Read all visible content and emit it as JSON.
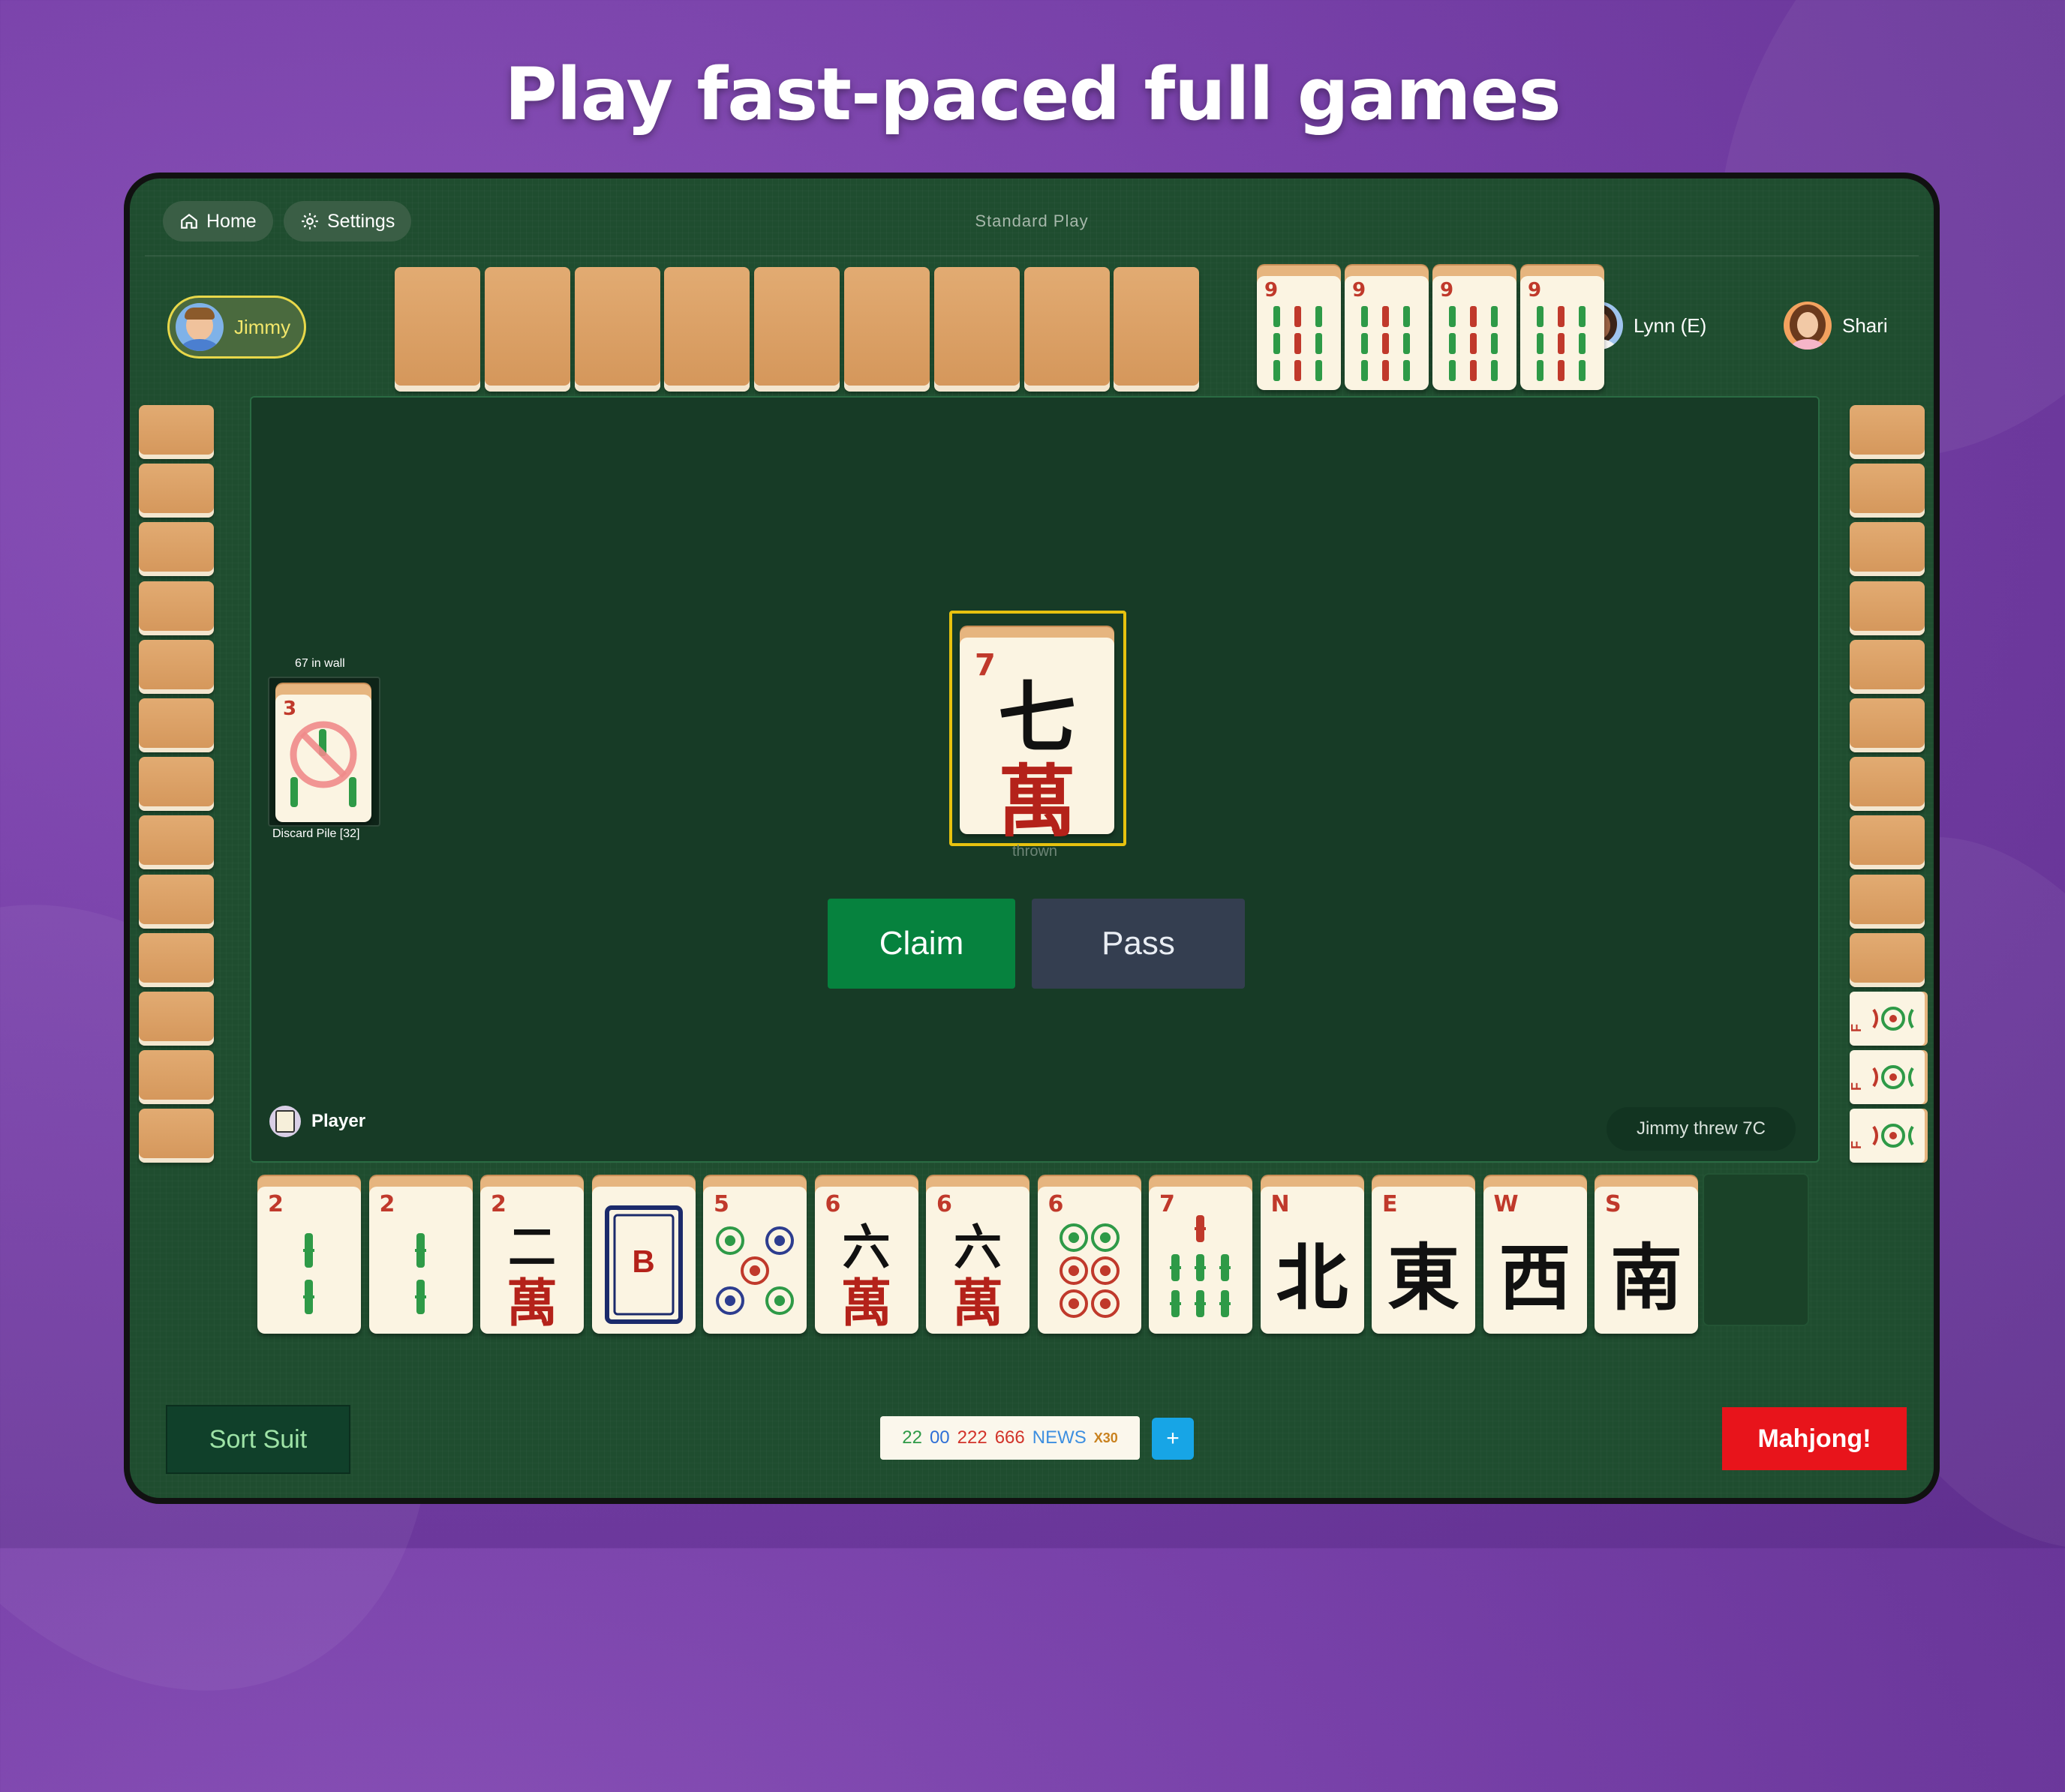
{
  "headline": "Play fast-paced full games",
  "nav": {
    "home": "Home",
    "settings": "Settings",
    "mode": "Standard Play"
  },
  "players": {
    "north": {
      "name": "Jimmy"
    },
    "east": {
      "name": "Lynn (E)"
    },
    "west": {
      "name": "Shari"
    },
    "south": {
      "name": "Player"
    }
  },
  "opponent_top": {
    "hidden_tiles": 9,
    "exposed": [
      {
        "rank": "9"
      },
      {
        "rank": "9"
      },
      {
        "rank": "9"
      },
      {
        "rank": "9"
      }
    ]
  },
  "left_wall": {
    "hidden_tiles": 13
  },
  "right_wall": {
    "hidden_tiles": 10,
    "exposed_tiles": 3,
    "exposed_rank": "F"
  },
  "wall_info": {
    "count_label": "67 in wall",
    "discard_label": "Discard Pile [32]",
    "discard_top_rank": "3"
  },
  "thrown": {
    "rank": "7",
    "label": "thrown",
    "character": "七"
  },
  "actions": {
    "claim": "Claim",
    "pass": "Pass"
  },
  "log": "Jimmy threw 7C",
  "hand": [
    {
      "rank": "2",
      "suit": "bam"
    },
    {
      "rank": "2",
      "suit": "bam"
    },
    {
      "rank": "2",
      "suit": "crak",
      "character": "二"
    },
    {
      "rank": "",
      "suit": "dragon",
      "character": "B"
    },
    {
      "rank": "5",
      "suit": "dot"
    },
    {
      "rank": "6",
      "suit": "crak",
      "character": "六"
    },
    {
      "rank": "6",
      "suit": "crak",
      "character": "六"
    },
    {
      "rank": "6",
      "suit": "dot"
    },
    {
      "rank": "7",
      "suit": "bam"
    },
    {
      "rank": "N",
      "suit": "wind",
      "character": "北"
    },
    {
      "rank": "E",
      "suit": "wind",
      "character": "東"
    },
    {
      "rank": "W",
      "suit": "wind",
      "character": "西"
    },
    {
      "rank": "S",
      "suit": "wind",
      "character": "南"
    }
  ],
  "wan_character": "萬",
  "bottom": {
    "sort": "Sort Suit",
    "pattern": [
      {
        "text": "22",
        "color": "#2e9a47"
      },
      {
        "text": "00",
        "color": "#2f6fd6"
      },
      {
        "text": "222",
        "color": "#d2342b"
      },
      {
        "text": "666",
        "color": "#d2342b"
      },
      {
        "text": "NEWS",
        "color": "#3d8fe0"
      }
    ],
    "multiplier": "X30",
    "plus": "+",
    "mahjong": "Mahjong!"
  },
  "colors": {
    "felt": "#1f4d2f",
    "table": "#173b26",
    "claim": "#06823e",
    "pass": "#343e50",
    "mahjong": "#e8141b"
  }
}
